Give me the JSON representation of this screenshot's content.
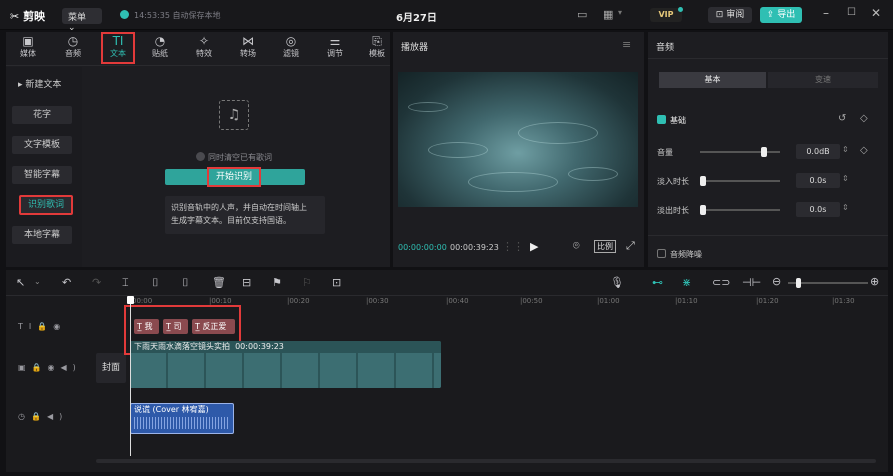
{
  "app": {
    "name": "剪映",
    "menu_label": "菜单",
    "save_status": "14:53:35 自动保存本地",
    "project_title": "6月27日"
  },
  "titlebar": {
    "vip_label": "VIP",
    "review_label": "审阅",
    "export_label": "导出"
  },
  "toolbar": [
    {
      "label": "媒体",
      "icon": "media-icon"
    },
    {
      "label": "音频",
      "icon": "audio-icon"
    },
    {
      "label": "文本",
      "icon": "text-icon"
    },
    {
      "label": "贴纸",
      "icon": "sticker-icon"
    },
    {
      "label": "特效",
      "icon": "effects-icon"
    },
    {
      "label": "转场",
      "icon": "transition-icon"
    },
    {
      "label": "滤镜",
      "icon": "filter-icon"
    },
    {
      "label": "调节",
      "icon": "adjust-icon"
    },
    {
      "label": "模板",
      "icon": "template-icon"
    }
  ],
  "text_sidebar": [
    {
      "label": "▸ 新建文本"
    },
    {
      "label": "花字"
    },
    {
      "label": "文字模板"
    },
    {
      "label": "智能字幕"
    },
    {
      "label": "识别歌词"
    },
    {
      "label": "本地字幕"
    }
  ],
  "lyrics": {
    "checkbox_label": "同时清空已有歌词",
    "start_button": "开始识别",
    "description_line1": "识别音轨中的人声，并自动在时间轴上",
    "description_line2": "生成字幕文本。目前仅支持国语。"
  },
  "player": {
    "title": "播放器",
    "current_time": "00:00:00:00",
    "total_time": "00:00:39:23",
    "ratio_label": "比例"
  },
  "audio_panel": {
    "title": "音频",
    "tabs": [
      "基本",
      "变速"
    ],
    "basic_label": "基础",
    "volume_label": "音量",
    "volume_value": "0.0dB",
    "fadein_label": "淡入时长",
    "fadein_value": "0.0s",
    "fadeout_label": "淡出时长",
    "fadeout_value": "0.0s",
    "denoise_label": "音频降噪",
    "volume_level": 0.82,
    "fadein_level": 0.0,
    "fadeout_level": 0.0
  },
  "timeline": {
    "ruler": [
      "00:00",
      "|00:10",
      "|00:20",
      "|00:30",
      "|00:40",
      "|00:50",
      "|01:00",
      "|01:10",
      "|01:20",
      "|01:30"
    ],
    "text_clips": [
      "我",
      "司",
      "反正爱"
    ],
    "video_clip_title": "下雨天雨水滴落空镜头实拍",
    "video_clip_duration": "00:00:39:23",
    "cover_label": "封面",
    "audio_clip_title": "说谎 (Cover 林宥嘉)"
  },
  "colors": {
    "accent": "#2fbfb3",
    "highlight": "#e23a3a",
    "text_clip": "#8a4a4f",
    "audio_clip": "#2e59a9"
  }
}
